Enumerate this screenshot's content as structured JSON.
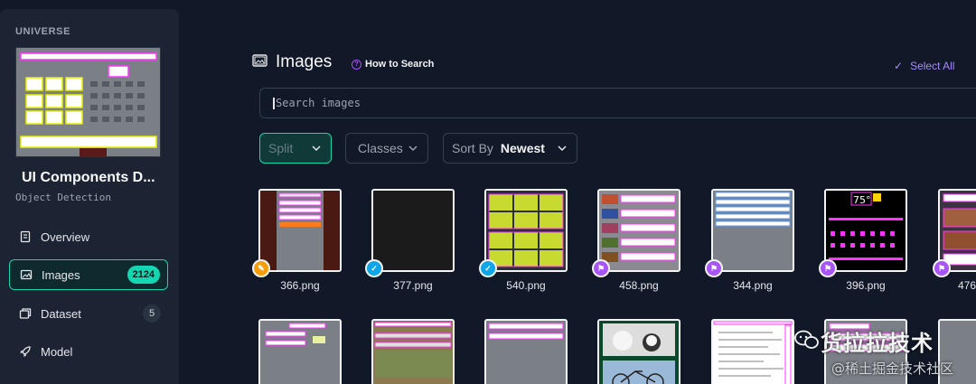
{
  "sidebar": {
    "workspace": "UNIVERSE",
    "project_title": "UI Components D...",
    "project_type": "Object Detection",
    "items": [
      {
        "label": "Overview",
        "icon": "document-icon",
        "badge": ""
      },
      {
        "label": "Images",
        "icon": "images-icon",
        "badge": "2124",
        "active": true
      },
      {
        "label": "Dataset",
        "icon": "dataset-icon",
        "badge": "5"
      },
      {
        "label": "Model",
        "icon": "rocket-icon",
        "badge": ""
      }
    ]
  },
  "header": {
    "title": "Images",
    "how_to": "How to Search",
    "select_all": "Select All"
  },
  "search": {
    "placeholder": "Search images"
  },
  "filters": {
    "split": "Split",
    "classes": "Classes",
    "sort_label": "Sort By",
    "sort_value": "Newest"
  },
  "images_row1": [
    {
      "name": "366.png",
      "status": "annotate",
      "status_color": "#f59e0b"
    },
    {
      "name": "377.png",
      "status": "verified",
      "status_color": "#0ea5e9"
    },
    {
      "name": "540.png",
      "status": "verified",
      "status_color": "#0ea5e9"
    },
    {
      "name": "458.png",
      "status": "running",
      "status_color": "#a855f7"
    },
    {
      "name": "344.png",
      "status": "running",
      "status_color": "#a855f7"
    },
    {
      "name": "396.png",
      "status": "running",
      "status_color": "#a855f7"
    },
    {
      "name": "476",
      "status": "running",
      "status_color": "#a855f7"
    }
  ],
  "watermark": {
    "line1": "货拉拉技术",
    "line2": "@稀土掘金技术社区"
  },
  "thumb_text": {
    "weather_temp": "75°"
  },
  "colors": {
    "accent": "#14d6b0",
    "purple": "#a855f7",
    "magenta": "#ff33ff"
  }
}
